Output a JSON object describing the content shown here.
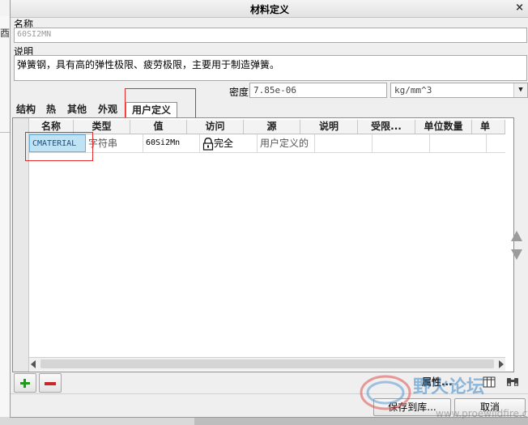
{
  "background": {
    "left_glyph": "酉"
  },
  "dialog": {
    "title": "材料定义",
    "close_glyph": "×"
  },
  "name_field": {
    "label": "名称",
    "value": "60SI2MN"
  },
  "description_field": {
    "label": "说明",
    "value": "弹簧钢，具有高的弹性极限、疲劳极限，主要用于制造弹簧。"
  },
  "density": {
    "label": "密度",
    "value": "7.85e-06",
    "unit": "kg/mm^3"
  },
  "tabs": [
    {
      "label": "结构",
      "active": false
    },
    {
      "label": "热",
      "active": false
    },
    {
      "label": "其他",
      "active": false
    },
    {
      "label": "外观",
      "active": false
    },
    {
      "label": "用户定义",
      "active": true
    }
  ],
  "table": {
    "columns": [
      "名称",
      "类型",
      "值",
      "访问",
      "源",
      "说明",
      "受限...",
      "单位数量",
      "单"
    ],
    "rows": [
      {
        "name": "CMATERIAL",
        "type": "字符串",
        "value": "60Si2Mn",
        "access": "完全",
        "access_icon": "lock-icon",
        "source": "用户定义的",
        "description": "",
        "restricted": "",
        "unit_quantity": ""
      }
    ]
  },
  "toolbar": {
    "properties_label": "属性..."
  },
  "footer": {
    "save_label": "保存到库...",
    "cancel_label": "取消"
  },
  "watermark": {
    "text": "野火论坛",
    "url": "www.proewildfire.cn"
  },
  "colors": {
    "highlight_border": "#e32b2b",
    "selected_cell": "#bfe2f4",
    "add_green": "#1f9a1f",
    "remove_red": "#c9262a"
  }
}
